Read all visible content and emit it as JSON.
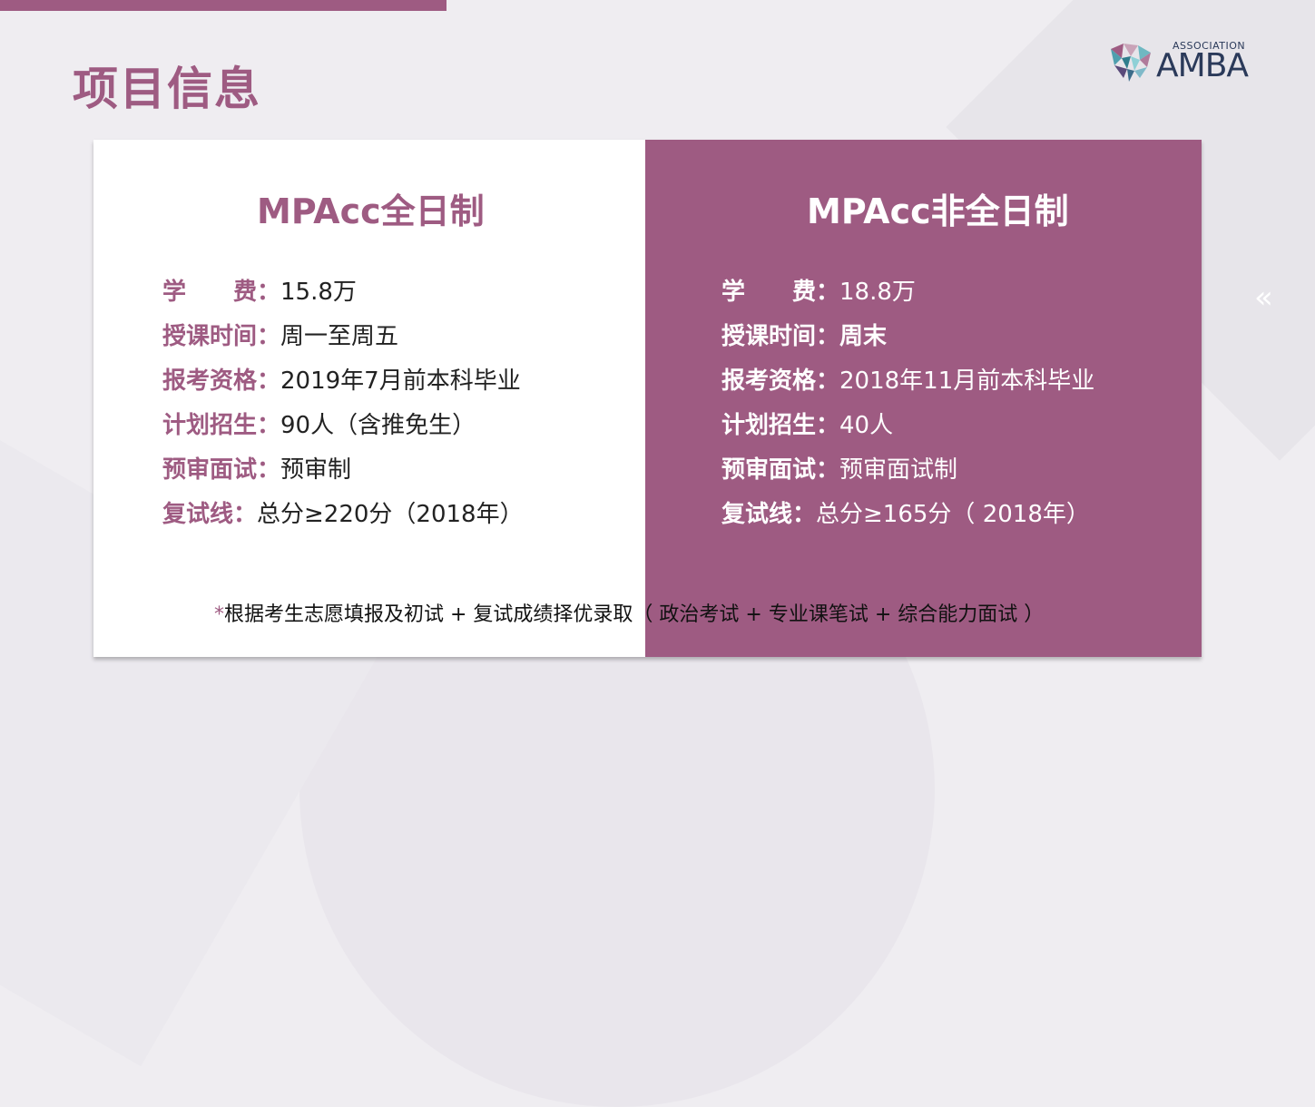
{
  "page_title": "项目信息",
  "logo": {
    "small_text": "ASSOCIATION",
    "big_text": "AMBA"
  },
  "left_panel": {
    "title": "MPAcc全日制",
    "rows": [
      {
        "label": "学　　费：",
        "value": "15.8万"
      },
      {
        "label": "授课时间：",
        "value": "周一至周五"
      },
      {
        "label": "报考资格：",
        "value": "2019年7月前本科毕业"
      },
      {
        "label": "计划招生：",
        "value": "90人（含推免生）"
      },
      {
        "label": "预审面试：",
        "value": "预审制"
      },
      {
        "label": "复试线：",
        "value": "总分≥220分（2018年）"
      }
    ]
  },
  "right_panel": {
    "title": "MPAcc非全日制",
    "rows": [
      {
        "label": "学　　费：",
        "value": "18.8万"
      },
      {
        "label": "授课时间：",
        "value": "周末"
      },
      {
        "label": "报考资格：",
        "value": "2018年11月前本科毕业"
      },
      {
        "label": "计划招生：",
        "value": "40人"
      },
      {
        "label": "预审面试：",
        "value": "预审面试制"
      },
      {
        "label": "复试线：",
        "value": "总分≥165分（ 2018年）"
      }
    ]
  },
  "footnote": {
    "star": "*",
    "text": "根据考生志愿填报及初试 + 复试成绩择优录取（ 政治考试 + 专业课笔试 + 综合能力面试 ）"
  },
  "nav": {
    "prev_icon": "double-chevron-left-icon",
    "prev_glyph": "«"
  },
  "colors": {
    "accent": "#9e5b82",
    "background": "#efedf1"
  }
}
